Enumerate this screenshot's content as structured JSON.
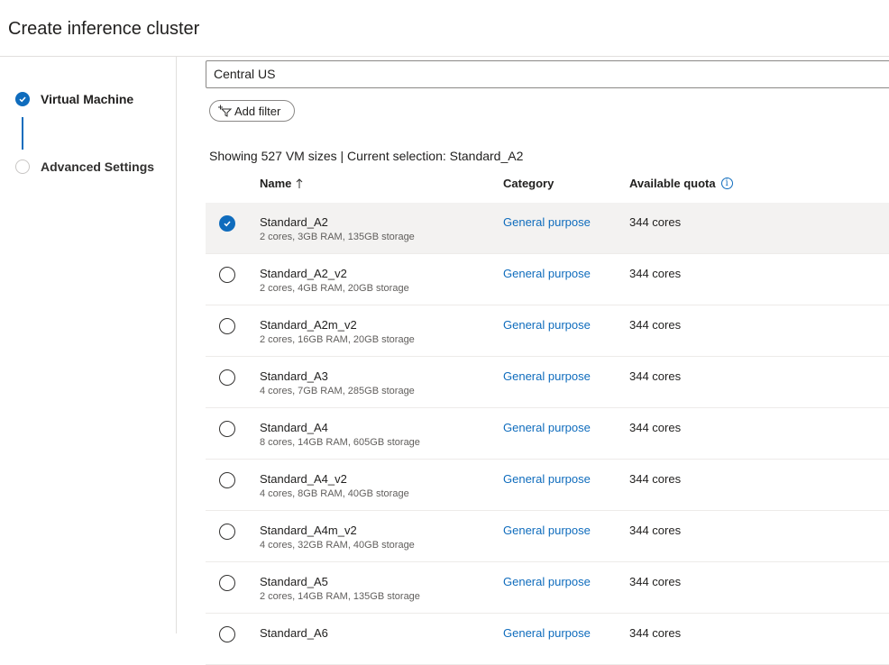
{
  "page": {
    "title": "Create inference cluster"
  },
  "steps": [
    {
      "label": "Virtual Machine",
      "status": "complete"
    },
    {
      "label": "Advanced Settings",
      "status": "pending"
    }
  ],
  "region": {
    "value": "Central US"
  },
  "filter": {
    "add_label": "Add filter"
  },
  "summary": "Showing 527 VM sizes | Current selection: Standard_A2",
  "table": {
    "columns": {
      "name": "Name",
      "category": "Category",
      "quota": "Available quota"
    },
    "sort": "Name ascending",
    "rows": [
      {
        "name": "Standard_A2",
        "spec": "2 cores, 3GB RAM, 135GB storage",
        "category": "General purpose",
        "quota": "344 cores",
        "selected": true
      },
      {
        "name": "Standard_A2_v2",
        "spec": "2 cores, 4GB RAM, 20GB storage",
        "category": "General purpose",
        "quota": "344 cores",
        "selected": false
      },
      {
        "name": "Standard_A2m_v2",
        "spec": "2 cores, 16GB RAM, 20GB storage",
        "category": "General purpose",
        "quota": "344 cores",
        "selected": false
      },
      {
        "name": "Standard_A3",
        "spec": "4 cores, 7GB RAM, 285GB storage",
        "category": "General purpose",
        "quota": "344 cores",
        "selected": false
      },
      {
        "name": "Standard_A4",
        "spec": "8 cores, 14GB RAM, 605GB storage",
        "category": "General purpose",
        "quota": "344 cores",
        "selected": false
      },
      {
        "name": "Standard_A4_v2",
        "spec": "4 cores, 8GB RAM, 40GB storage",
        "category": "General purpose",
        "quota": "344 cores",
        "selected": false
      },
      {
        "name": "Standard_A4m_v2",
        "spec": "4 cores, 32GB RAM, 40GB storage",
        "category": "General purpose",
        "quota": "344 cores",
        "selected": false
      },
      {
        "name": "Standard_A5",
        "spec": "2 cores, 14GB RAM, 135GB storage",
        "category": "General purpose",
        "quota": "344 cores",
        "selected": false
      },
      {
        "name": "Standard_A6",
        "spec": "",
        "category": "General purpose",
        "quota": "344 cores",
        "selected": false
      }
    ]
  },
  "colors": {
    "accent": "#0f6cbd",
    "selected_row": "#f3f2f1"
  }
}
